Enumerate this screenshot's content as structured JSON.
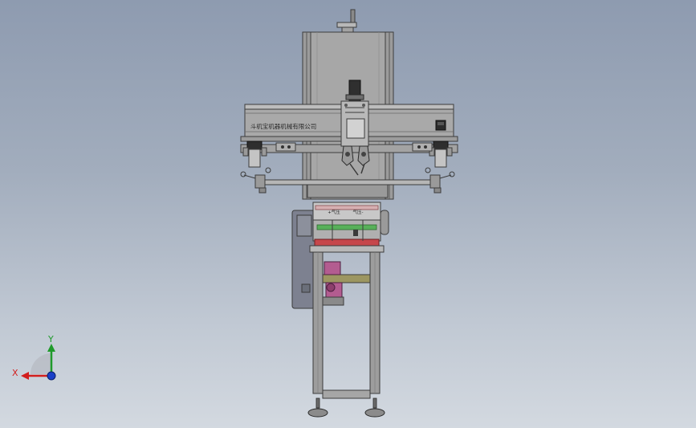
{
  "viewport": {
    "background_top": "#8e9bb0",
    "background_bottom": "#d3d9e0"
  },
  "model": {
    "company_name": "斗机宝机器机械有限公司",
    "left_sign": "+气压",
    "right_sign": "气压-",
    "colors": {
      "frame": "#9d9d9d",
      "frame_dark": "#6a6a6a",
      "outline": "#3c3c3c",
      "panel": "#a7a7a7",
      "enclosure": "#7d8190",
      "red": "#c6474b",
      "green": "#58b05a",
      "magenta": "#b35c90",
      "olive": "#9c9661"
    }
  },
  "triad": {
    "x_label": "X",
    "y_label": "Y",
    "x_color": "#d21e1e",
    "y_color": "#1f9a2b",
    "z_color": "#1a3fc8"
  }
}
